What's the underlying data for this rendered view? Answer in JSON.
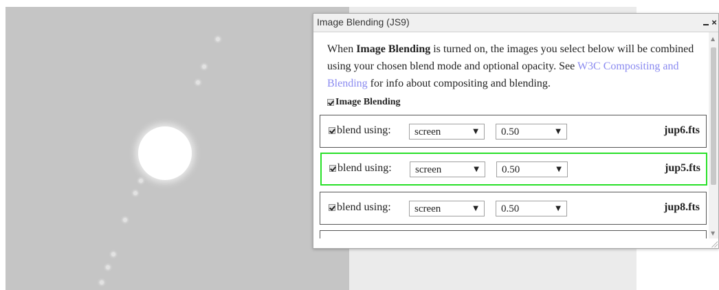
{
  "dialog": {
    "title": "Image Blending (JS9)",
    "minimize_label": "_",
    "close_label": "×"
  },
  "description": {
    "text_1": "When ",
    "bold_term": "Image Blending",
    "text_2": " is turned on, the images you select below will be combined using your chosen blend mode and optional opacity. See ",
    "link_text": "W3C Compositing and Blending",
    "text_3": " for info about compositing and blending."
  },
  "master_toggle": {
    "label": "Image Blending",
    "checked": true
  },
  "blend_label": "blend using:",
  "select_arrow": "▼",
  "rows": [
    {
      "checked": true,
      "mode": "screen",
      "opacity": "0.50",
      "file": "jup6.fts",
      "active": false
    },
    {
      "checked": true,
      "mode": "screen",
      "opacity": "0.50",
      "file": "jup5.fts",
      "active": true
    },
    {
      "checked": true,
      "mode": "screen",
      "opacity": "0.50",
      "file": "jup8.fts",
      "active": false
    }
  ],
  "scrollbar": {
    "up_arrow": "▲",
    "down_arrow": "▼"
  },
  "colors": {
    "active_row_border": "#27e027",
    "link": "#8a8af0",
    "image_background": "#c5c5c5"
  }
}
